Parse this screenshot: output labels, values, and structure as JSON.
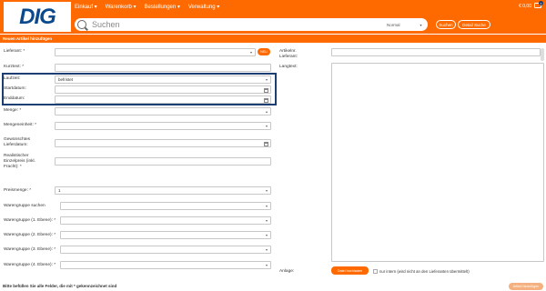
{
  "header": {
    "logo": "DIG",
    "nav": [
      {
        "label": "Einkauf ▾"
      },
      {
        "label": "Warenkorb ▾"
      },
      {
        "label": "Bestellungen ▾"
      },
      {
        "label": "Verwaltung ▾"
      }
    ],
    "cart_total": "€ 0,00",
    "cart_count": "0"
  },
  "search": {
    "placeholder": "Suchen",
    "mode": "Normal",
    "search_button": "Suchen",
    "detail_button": "Detail Suche"
  },
  "panel": {
    "title": "Neuen Artikel hinzufügen"
  },
  "form": {
    "lieferant_label": "Lieferant: *",
    "neu_button": "NEU",
    "kurztext_label": "Kurztext: *",
    "laufzeit_label": "Laufzeit:",
    "laufzeit_value": "befristet",
    "startdatum_label": "Startdatum:",
    "enddatum_label": "Enddatum:",
    "menge_label": "Menge: *",
    "mengeneinheit_label": "Mengeneinheit: *",
    "lieferdatum_label": "Gewünschtes Lieferdatum:",
    "einzelpreis_label": "Realistischer Einzelpreis (inkl. Fracht): *",
    "preismenge_label": "Preismenge: *",
    "preismenge_value": "1",
    "wg_suchen_label": "Warengruppe suchen",
    "wg1_label": "Warengruppe (1. Ebene): *",
    "wg2_label": "Warengruppe (2. Ebene): *",
    "wg3_label": "Warengruppe (3. Ebene): *",
    "wg4_label": "Warengruppe (4. Ebene): *",
    "artikelnr_label": "Artikelnr. Lieferant:",
    "langtext_label": "Langtext:",
    "anlage_label": "Anlage:",
    "datei_button": "Datei hochladen",
    "intern_label": "nur intern (wird nicht an den Lieferanten übermittelt)",
    "footer_note": "Bitte befüllen Sie alle Felder, die mit * gekennzeichnet sind",
    "submit_button": "Artikel hinzufügen"
  }
}
